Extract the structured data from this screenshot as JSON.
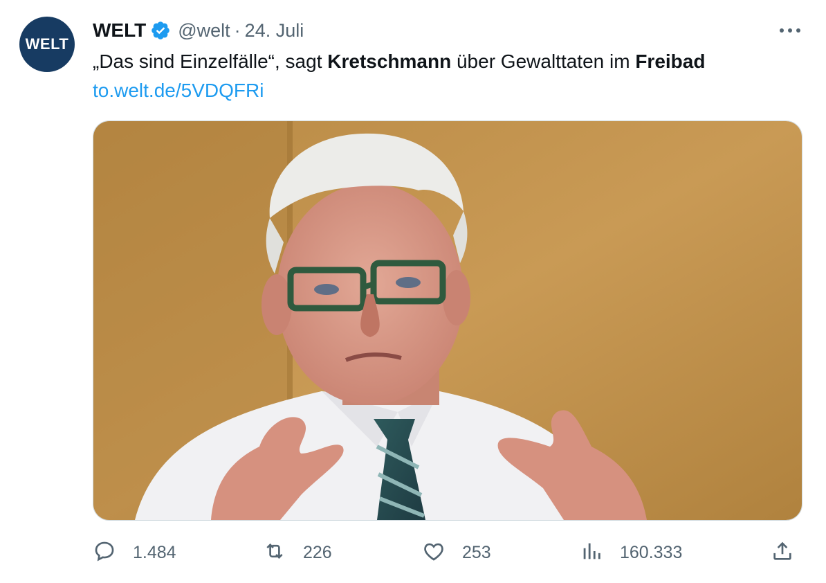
{
  "author": {
    "name": "WELT",
    "handle": "@welt",
    "separator": "·",
    "date": "24. Juli",
    "avatar_text": "WELT"
  },
  "tweet": {
    "text_part1": "„Das sind Einzelfälle“, sagt ",
    "text_bold1": "Kretschmann",
    "text_part2": " über Gewalttaten im ",
    "text_bold2": "Freibad",
    "link": "to.welt.de/5VDQFRi"
  },
  "media": {
    "description": "photo",
    "icon": "photo"
  },
  "actions": {
    "replies": "1.484",
    "retweets": "226",
    "likes": "253",
    "views": "160.333"
  },
  "icons": {
    "verified": "verified-badge-icon",
    "more": "more-icon",
    "reply": "reply-icon",
    "retweet": "retweet-icon",
    "like": "heart-icon",
    "views": "views-icon",
    "share": "share-icon"
  },
  "colors": {
    "accent": "#1d9bf0",
    "secondary_text": "#536471",
    "avatar_bg": "#173b62"
  }
}
